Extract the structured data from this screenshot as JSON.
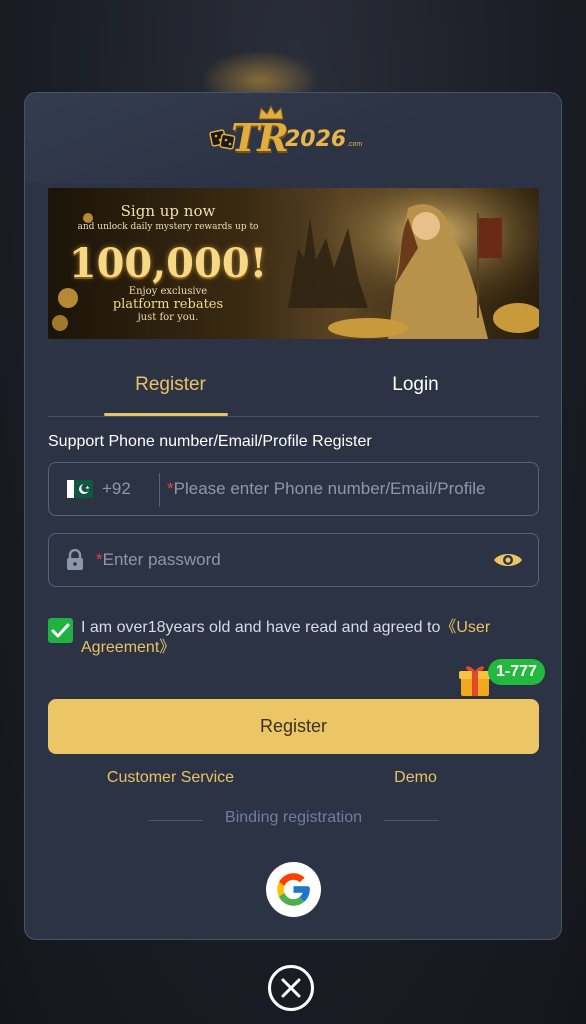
{
  "logo": {
    "text": "TR",
    "year": "2026",
    "suffix": ".com"
  },
  "banner": {
    "line1": "Sign up now",
    "line2": "and unlock daily mystery rewards up to",
    "amount": "100,000!",
    "line3": "Enjoy exclusive",
    "line4": "platform rebates",
    "line5": "just for you."
  },
  "tabs": {
    "register": "Register",
    "login": "Login",
    "active": "Register"
  },
  "form": {
    "support_label": "Support Phone number/Email/Profile Register",
    "country_code": "+92",
    "required_mark": "*",
    "phone_placeholder": "Please enter Phone number/Email/Profile",
    "password_placeholder": "Enter password",
    "agree_checked": true,
    "agree_text": "I am over18years old and have read and agreed to",
    "agree_link": "《User Agreement》"
  },
  "promo": {
    "badge": "1-777"
  },
  "actions": {
    "register": "Register",
    "customer_service": "Customer Service",
    "demo": "Demo",
    "binding": "Binding registration"
  },
  "colors": {
    "accent": "#ecc564",
    "panel": "#2c3344",
    "success": "#1fb141"
  },
  "icons": [
    "pakistan-flag-icon",
    "lock-icon",
    "eye-icon",
    "check-icon",
    "gift-icon",
    "google-icon",
    "close-icon"
  ]
}
